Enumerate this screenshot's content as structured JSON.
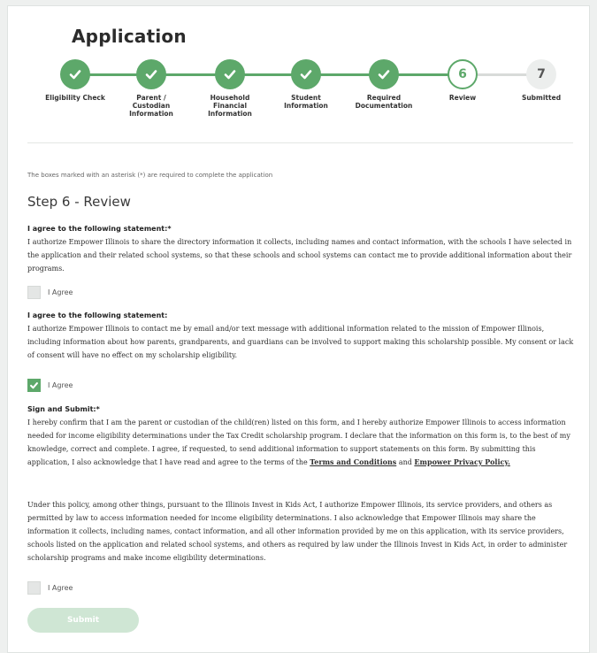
{
  "page": {
    "title": "Application"
  },
  "stepper": {
    "steps": [
      {
        "label": "Eligibility Check",
        "status": "complete",
        "icon": "check-icon"
      },
      {
        "label": "Parent /\nCustodian\nInformation",
        "status": "complete",
        "icon": "check-icon"
      },
      {
        "label": "Household\nFinancial\nInformation",
        "status": "complete",
        "icon": "check-icon"
      },
      {
        "label": "Student\nInformation",
        "status": "complete",
        "icon": "check-icon"
      },
      {
        "label": "Required\nDocumentation",
        "status": "complete",
        "icon": "check-icon"
      },
      {
        "label": "Review",
        "status": "current",
        "number": "6"
      },
      {
        "label": "Submitted",
        "status": "upcoming",
        "number": "7"
      }
    ]
  },
  "form": {
    "required_note": "The boxes marked with an asterisk (*) are required to complete the application",
    "step_heading": "Step 6 - Review",
    "sections": [
      {
        "heading": "I agree to the following statement:*",
        "body": "I authorize Empower Illinois to share the directory information it collects, including names and contact information, with the schools I have selected in the application and their related school systems, so that these schools and school systems can contact me to provide additional information about their programs.",
        "checkbox": {
          "label": "I Agree",
          "checked": false
        }
      },
      {
        "heading": "I agree to the following statement:",
        "body": "I authorize Empower Illinois to contact me by email and/or text message with additional information related to the mission of Empower Illinois, including information about how parents, grandparents, and guardians can be involved to support making this scholarship possible. My consent or lack of consent will have no effect on my scholarship eligibility.",
        "checkbox": {
          "label": "I Agree",
          "checked": true
        }
      },
      {
        "heading": "Sign and Submit:*",
        "body_before_links": "I hereby confirm that I am the parent or custodian of the child(ren) listed on this form, and I hereby authorize Empower Illinois to access information needed for income eligibility determinations under the Tax Credit scholarship program. I declare that the information on this form is, to the best of my knowledge, correct and complete. I agree, if requested, to send additional information to support statements on this form. By submitting this application, I also acknowledge that I have read and agree to the terms of the",
        "terms_link": "Terms and Conditions",
        "and_text": "and",
        "privacy_link": "Empower Privacy Policy.",
        "body2": "Under this policy, among other things, pursuant to the Illinois Invest in Kids Act, I authorize Empower Illinois, its service providers, and others as permitted by law to access information needed for income eligibility determinations. I also acknowledge that Empower Illinois may share the information it collects, including names, contact information, and all other information provided by me on this application, with its service providers, schools listed on the application and related school systems, and others as required by law under the Illinois Invest in Kids Act, in order to administer scholarship programs and make income eligibility determinations.",
        "checkbox": {
          "label": "I Agree",
          "checked": false
        }
      }
    ],
    "submit_label": "Submit"
  },
  "colors": {
    "accent": "#5da86a",
    "accent_disabled": "#cfe6d4",
    "page_background": "#eef0ef"
  }
}
